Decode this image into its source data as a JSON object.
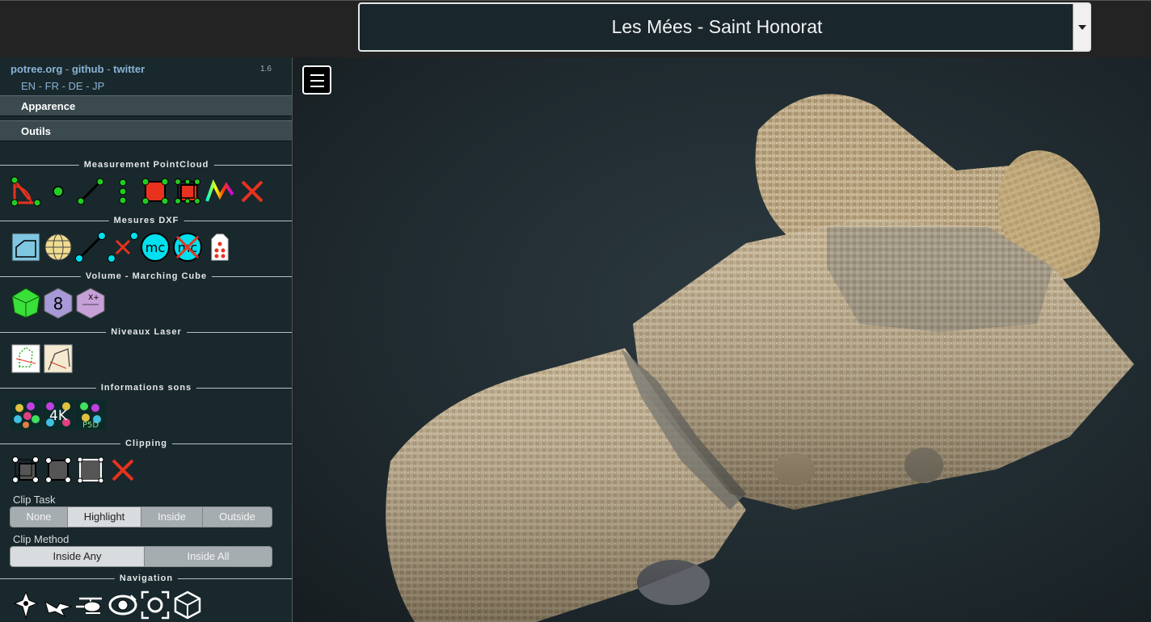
{
  "topbar": {
    "project_select": "Les Mées - Saint Honorat"
  },
  "sidebar": {
    "links": [
      "potree.org",
      "github",
      "twitter"
    ],
    "link_sep": " - ",
    "version": "1.6",
    "languages": [
      "EN",
      "FR",
      "DE",
      "JP"
    ],
    "accordions": [
      "Apparence",
      "Outils"
    ],
    "sections": {
      "measurement": "Measurement PointCloud",
      "dxf": "Mesures DXF",
      "volume": "Volume - Marching Cube",
      "laser": "Niveaux Laser",
      "sounds": "Informations sons",
      "clipping": "Clipping",
      "navigation": "Navigation"
    },
    "volume_icons": {
      "count_label": "8",
      "xplus_label": "X+"
    },
    "dxf_icons": {
      "mc_label": "mc"
    },
    "sounds_icons": {
      "k_label": "4K",
      "p_label": "P5D"
    },
    "clip_task": {
      "label": "Clip Task",
      "options": [
        "None",
        "Highlight",
        "Inside",
        "Outside"
      ],
      "selected": "Highlight"
    },
    "clip_method": {
      "label": "Clip Method",
      "options": [
        "Inside Any",
        "Inside All"
      ],
      "selected": "Inside Any"
    }
  },
  "colors": {
    "accent_red": "#e8321e",
    "accent_green": "#22cc22",
    "accent_cyan": "#00e0ee",
    "sidebar_bg": "#19282c"
  }
}
